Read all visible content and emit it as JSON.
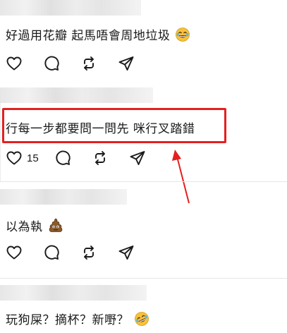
{
  "posts": [
    {
      "text": "好過用花瓣 起馬唔會周地垃圾",
      "emoji": "laughing-tears-emoji",
      "like_count": ""
    },
    {
      "text": "行每一步都要問一問先 咪行叉踏錯",
      "emoji": "",
      "like_count": "15"
    },
    {
      "text": "以為執",
      "emoji": "poop-emoji",
      "like_count": ""
    },
    {
      "text": "玩狗屎？摘杯？新嘢？",
      "emoji": "rolling-laughing-emoji",
      "like_count": ""
    }
  ],
  "colors": {
    "annotation": "#e32020",
    "text": "#1a1a1a",
    "divider": "#e6e6e6"
  },
  "icons": [
    "heart-icon",
    "comment-icon",
    "repost-icon",
    "share-icon"
  ]
}
